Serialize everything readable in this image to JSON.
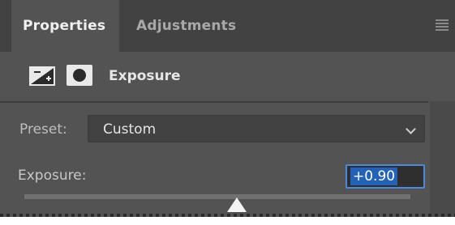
{
  "tabs": [
    {
      "label": "Properties",
      "active": true
    },
    {
      "label": "Adjustments",
      "active": false
    }
  ],
  "panel_menu_icon": "hamburger-icon",
  "header": {
    "adjustment_icon": "exposure-adjustment-icon",
    "mask_icon": "layer-mask-icon",
    "title": "Exposure"
  },
  "preset": {
    "label": "Preset:",
    "value": "Custom",
    "dropdown_icon": "chevron-down-icon"
  },
  "exposure": {
    "label": "Exposure:",
    "value": "+0.90",
    "slider_position": 0.55
  },
  "colors": {
    "panel": "#535353",
    "tabbar": "#424242",
    "focus_accent": "#4e88d8",
    "selection": "#2462b8"
  }
}
